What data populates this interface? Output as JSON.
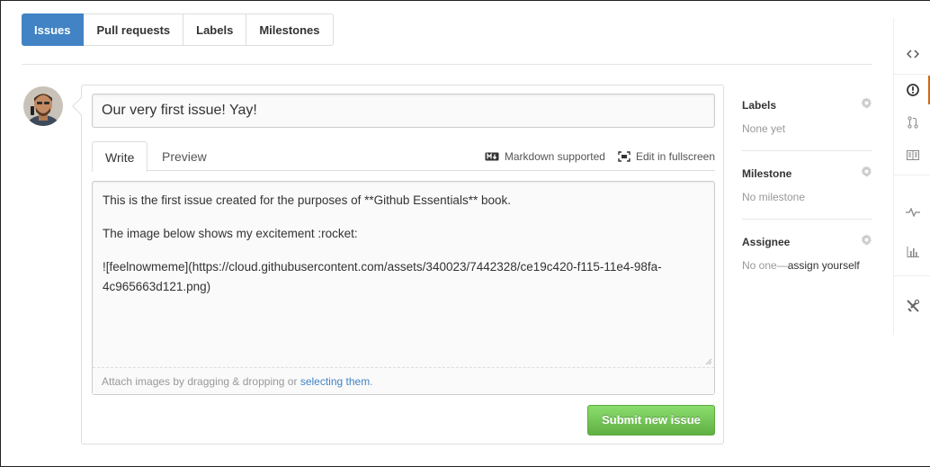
{
  "nav_tabs": [
    {
      "label": "Issues",
      "active": true
    },
    {
      "label": "Pull requests",
      "active": false
    },
    {
      "label": "Labels",
      "active": false
    },
    {
      "label": "Milestones",
      "active": false
    }
  ],
  "composer": {
    "title_value": "Our very first issue! Yay!",
    "tabs": {
      "write": "Write",
      "preview": "Preview"
    },
    "markdown_link": "Markdown supported",
    "fullscreen_link": "Edit in fullscreen",
    "body_lines": [
      "This is the first issue created for the purposes of **Github Essentials** book.",
      "The image below shows my excitement :rocket:",
      "![feelnowmeme](https://cloud.githubusercontent.com/assets/340023/7442328/ce19c420-f115-11e4-98fa-4c965663d121.png)"
    ],
    "attach_prefix": "Attach images by dragging & dropping or ",
    "attach_link": "selecting them",
    "attach_suffix": ".",
    "submit_label": "Submit new issue"
  },
  "sidebar": {
    "labels": {
      "heading": "Labels",
      "value": "None yet"
    },
    "milestone": {
      "heading": "Milestone",
      "value": "No milestone"
    },
    "assignee": {
      "heading": "Assignee",
      "value_prefix": "No one—",
      "value_link": "assign yourself"
    }
  },
  "rail_icons": [
    "code-icon",
    "issue-icon",
    "pull-request-icon",
    "wiki-icon",
    "pulse-icon",
    "graph-icon",
    "settings-icon"
  ],
  "colors": {
    "accent": "#4183c4",
    "submit": "#60b044",
    "rail_active": "#d26911"
  }
}
